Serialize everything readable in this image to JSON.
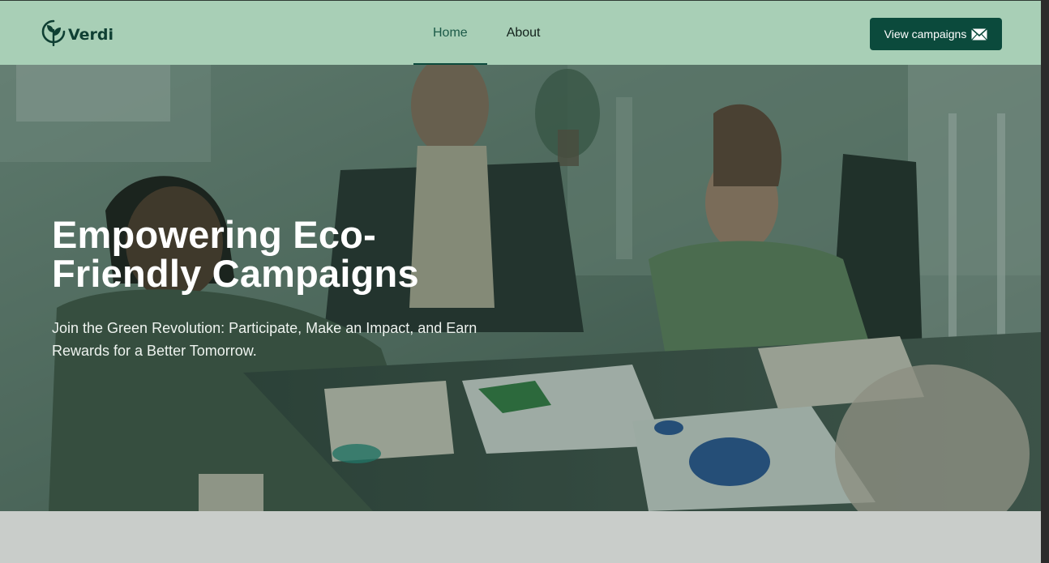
{
  "brand": {
    "name": "Verdi",
    "logo_icon": "leaf-in-circle-icon",
    "color": "#0f3f33"
  },
  "nav": {
    "items": [
      {
        "label": "Home",
        "active": true
      },
      {
        "label": "About",
        "active": false
      }
    ]
  },
  "cta": {
    "label": "View campaigns",
    "icon": "envelope-icon"
  },
  "hero": {
    "title": "Empowering Eco-Friendly Campaigns",
    "subtitle": "Join the Green Revolution: Participate, Make an Impact, and Earn Rewards for a Better Tomorrow.",
    "image": "team-meeting-photo"
  },
  "colors": {
    "header_bg": "#a8cfb6",
    "accent": "#0b4a3c",
    "below_fold_bg": "#c9cdca"
  }
}
